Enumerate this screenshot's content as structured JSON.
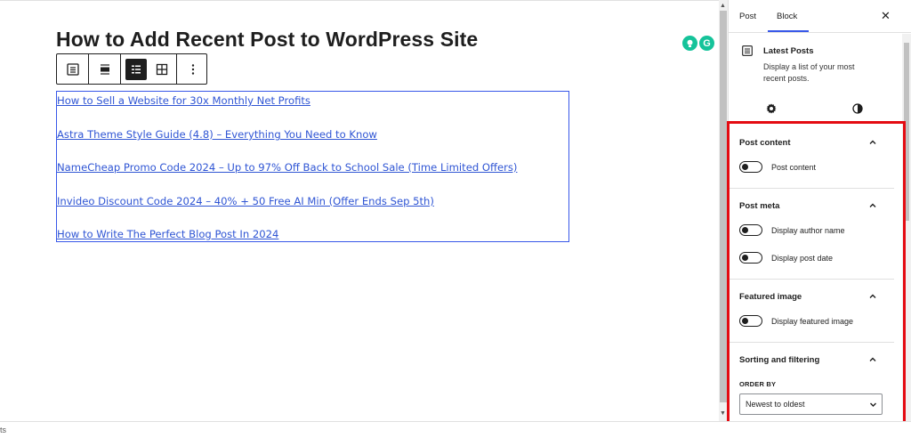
{
  "editor": {
    "post_title": "How to Add Recent Post to WordPress Site",
    "latest_posts": [
      "How to Sell a Website for 30x Monthly Net Profits",
      "Astra Theme Style Guide (4.8) – Everything You Need to Know",
      "NameCheap Promo Code 2024 – Up to 97% Off Back to School Sale (Time Limited Offers)",
      "Invideo Discount Code 2024 – 40% + 50 Free AI Min (Offer Ends Sep 5th)",
      "How to Write The Perfect Blog Post In 2024"
    ],
    "toolbar_icons": [
      "latest-posts-block-icon",
      "align-icon",
      "list-view-icon",
      "grid-view-icon",
      "more-options-icon"
    ]
  },
  "extensions": {
    "grammarly_badge": "G"
  },
  "sidebar": {
    "tabs": {
      "post": "Post",
      "block": "Block"
    },
    "block_card": {
      "title": "Latest Posts",
      "description": "Display a list of your most recent posts."
    },
    "panels": {
      "post_content": {
        "title": "Post content",
        "toggle_label": "Post content"
      },
      "post_meta": {
        "title": "Post meta",
        "author_label": "Display author name",
        "date_label": "Display post date"
      },
      "featured_image": {
        "title": "Featured image",
        "toggle_label": "Display featured image"
      },
      "sorting": {
        "title": "Sorting and filtering",
        "order_label": "ORDER BY",
        "order_value": "Newest to oldest"
      }
    }
  },
  "footer": {
    "text": "ts"
  },
  "colors": {
    "link": "#2f55d4",
    "block_outline": "#3858e9",
    "highlight": "#e40b12",
    "grammarly": "#15c39a"
  }
}
